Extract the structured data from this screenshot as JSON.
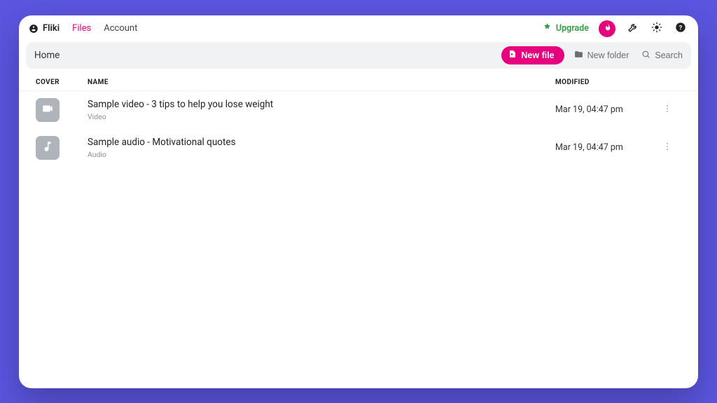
{
  "brand": {
    "name": "Fliki"
  },
  "nav": {
    "files": "Files",
    "account": "Account"
  },
  "upgrade": {
    "label": "Upgrade"
  },
  "breadcrumb": "Home",
  "toolbar": {
    "new_file": "New file",
    "new_folder": "New folder",
    "search": "Search"
  },
  "columns": {
    "cover": "COVER",
    "name": "NAME",
    "modified": "MODIFIED"
  },
  "files": [
    {
      "name": "Sample video - 3 tips to help you lose weight",
      "type": "Video",
      "modified": "Mar 19, 04:47 pm",
      "icon": "video"
    },
    {
      "name": "Sample audio - Motivational quotes",
      "type": "Audio",
      "modified": "Mar 19, 04:47 pm",
      "icon": "audio"
    }
  ]
}
